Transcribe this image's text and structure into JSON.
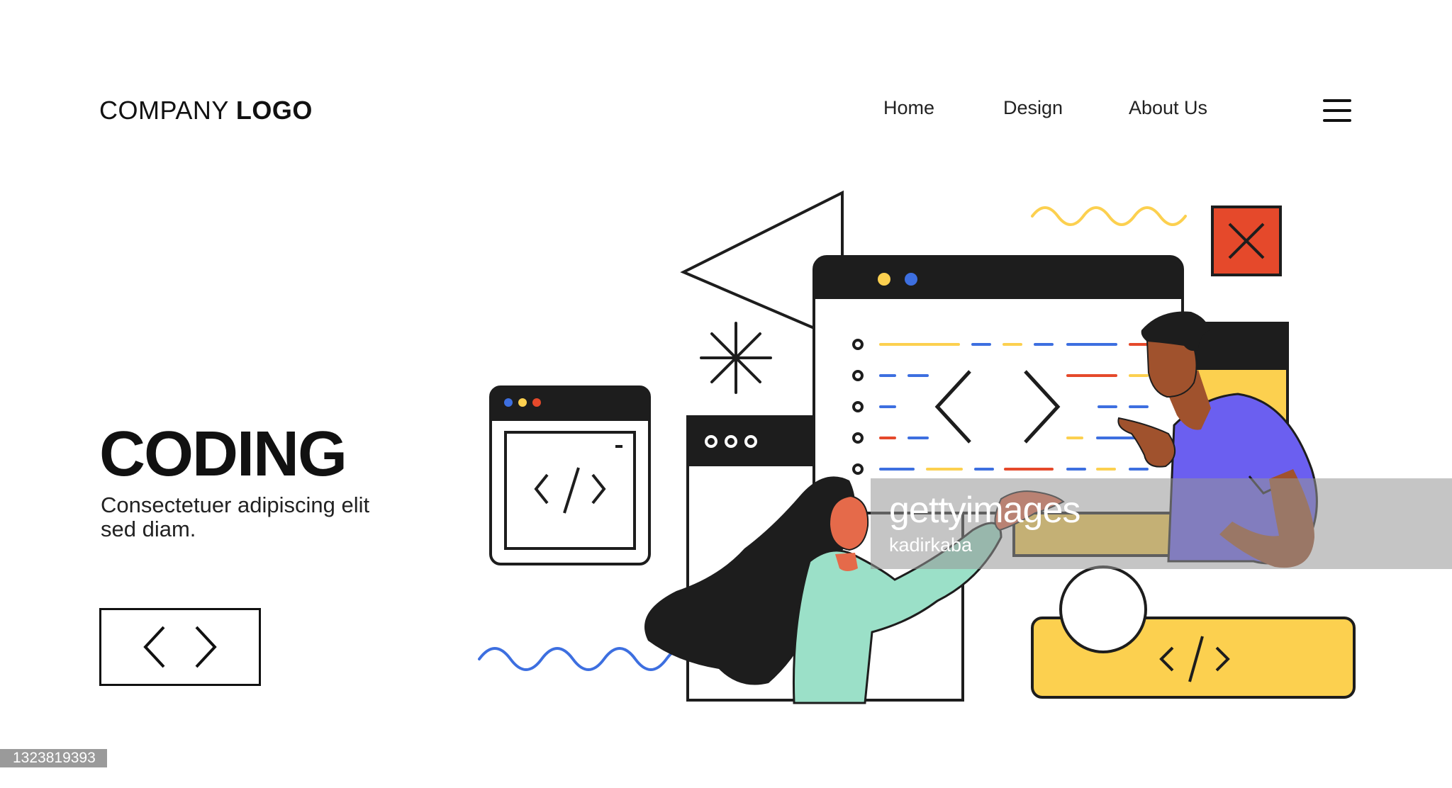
{
  "header": {
    "logo_regular": "COMPANY",
    "logo_bold": "LOGO",
    "nav": [
      {
        "label": "Home"
      },
      {
        "label": "Design"
      },
      {
        "label": "About Us"
      }
    ],
    "menu_icon": "hamburger-menu-icon"
  },
  "hero": {
    "title": "CODING",
    "subtitle": "Consectetuer adipiscing elit sed diam.",
    "code_button_icon": "code-brackets-icon"
  },
  "illustration": {
    "code_glyph": "</>",
    "colors": {
      "dark": "#1d1d1d",
      "yellow": "#fcd04f",
      "blue": "#3d6fe0",
      "red": "#e5492b",
      "mint": "#9be0c8",
      "purple": "#6b5ff0",
      "skin_dark": "#a0522d",
      "skin_light": "#e56a4a"
    }
  },
  "watermark": {
    "brand": "gettyimages",
    "author": "kadirkaba",
    "stock_id": "1323819393"
  }
}
